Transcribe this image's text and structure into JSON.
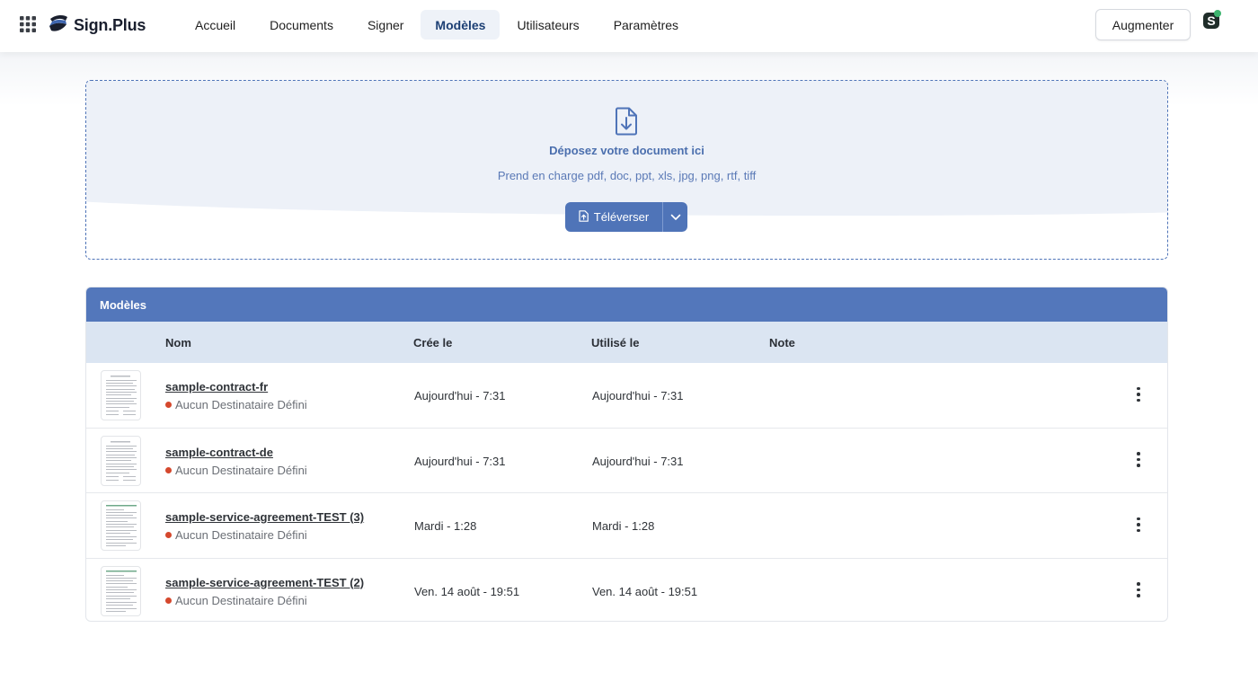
{
  "brand": {
    "name": "Sign.Plus"
  },
  "nav": {
    "items": [
      {
        "label": "Accueil",
        "active": false
      },
      {
        "label": "Documents",
        "active": false
      },
      {
        "label": "Signer",
        "active": false
      },
      {
        "label": "Modèles",
        "active": true
      },
      {
        "label": "Utilisateurs",
        "active": false
      },
      {
        "label": "Paramètres",
        "active": false
      }
    ]
  },
  "header": {
    "upgrade_label": "Augmenter"
  },
  "dropzone": {
    "title": "Déposez votre document ici",
    "subtitle": "Prend en charge pdf, doc, ppt, xls, jpg, png, rtf, tiff",
    "upload_label": "Téléverser"
  },
  "templates": {
    "title": "Modèles",
    "columns": {
      "name": "Nom",
      "created": "Crée le",
      "used": "Utilisé le",
      "note": "Note"
    },
    "rows": [
      {
        "name": "sample-contract-fr",
        "recipients": "Aucun Destinataire Défini",
        "created": "Aujourd'hui - 7:31",
        "used": "Aujourd'hui - 7:31",
        "note": ""
      },
      {
        "name": "sample-contract-de",
        "recipients": "Aucun Destinataire Défini",
        "created": "Aujourd'hui - 7:31",
        "used": "Aujourd'hui - 7:31",
        "note": ""
      },
      {
        "name": "sample-service-agreement-TEST (3)",
        "recipients": "Aucun Destinataire Défini",
        "created": "Mardi - 1:28",
        "used": "Mardi - 1:28",
        "note": ""
      },
      {
        "name": "sample-service-agreement-TEST (2)",
        "recipients": "Aucun Destinataire Défini",
        "created": "Ven. 14 août - 19:51",
        "used": "Ven. 14 août - 19:51",
        "note": ""
      }
    ]
  },
  "colors": {
    "accent": "#4f74b8",
    "header_bg": "#5377bb",
    "table_head_bg": "#dbe5f2",
    "status_dot": "#d5482d"
  },
  "icons": [
    "apps-grid-icon",
    "sign-plus-logo-icon",
    "user-avatar-icon",
    "file-download-icon",
    "file-upload-icon",
    "chevron-down-icon",
    "more-vertical-icon"
  ]
}
